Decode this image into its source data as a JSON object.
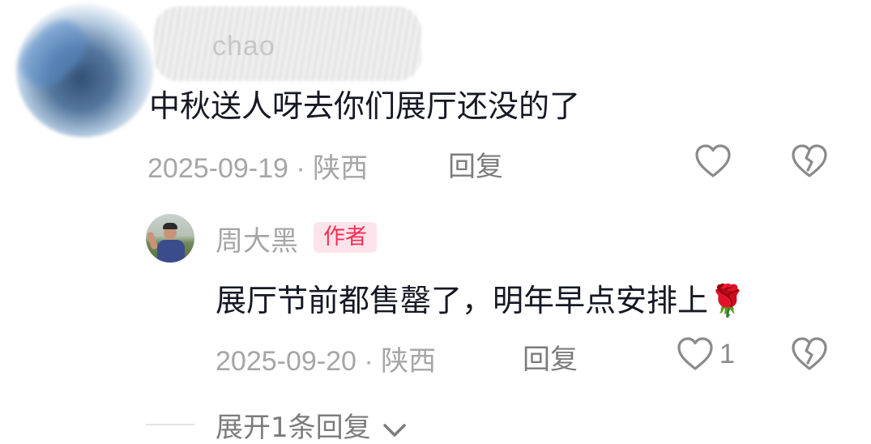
{
  "top_comment": {
    "user_name_redacted": "chao",
    "text": "中秋送人呀去你们展厅还没的了",
    "date": "2025-09-19",
    "location": "· 陕西",
    "reply_label": "回复",
    "like_icon": "heart-outline-icon",
    "dislike_icon": "broken-heart-icon"
  },
  "author_reply": {
    "name": "周大黑",
    "badge": "作者",
    "text": "展厅节前都售罄了，明年早点安排上",
    "emoji": "🌹",
    "date": "2025-09-20",
    "location": "· 陕西",
    "reply_label": "回复",
    "like_count": "1",
    "like_icon": "heart-outline-icon",
    "dislike_icon": "broken-heart-icon"
  },
  "expand_replies": {
    "label": "展开1条回复",
    "icon": "chevron-down-icon"
  },
  "colors": {
    "text_primary": "#161823",
    "text_meta": "#a6a6a6",
    "author_badge_text": "#fe2c55",
    "author_badge_bg": "#fde4ea"
  }
}
